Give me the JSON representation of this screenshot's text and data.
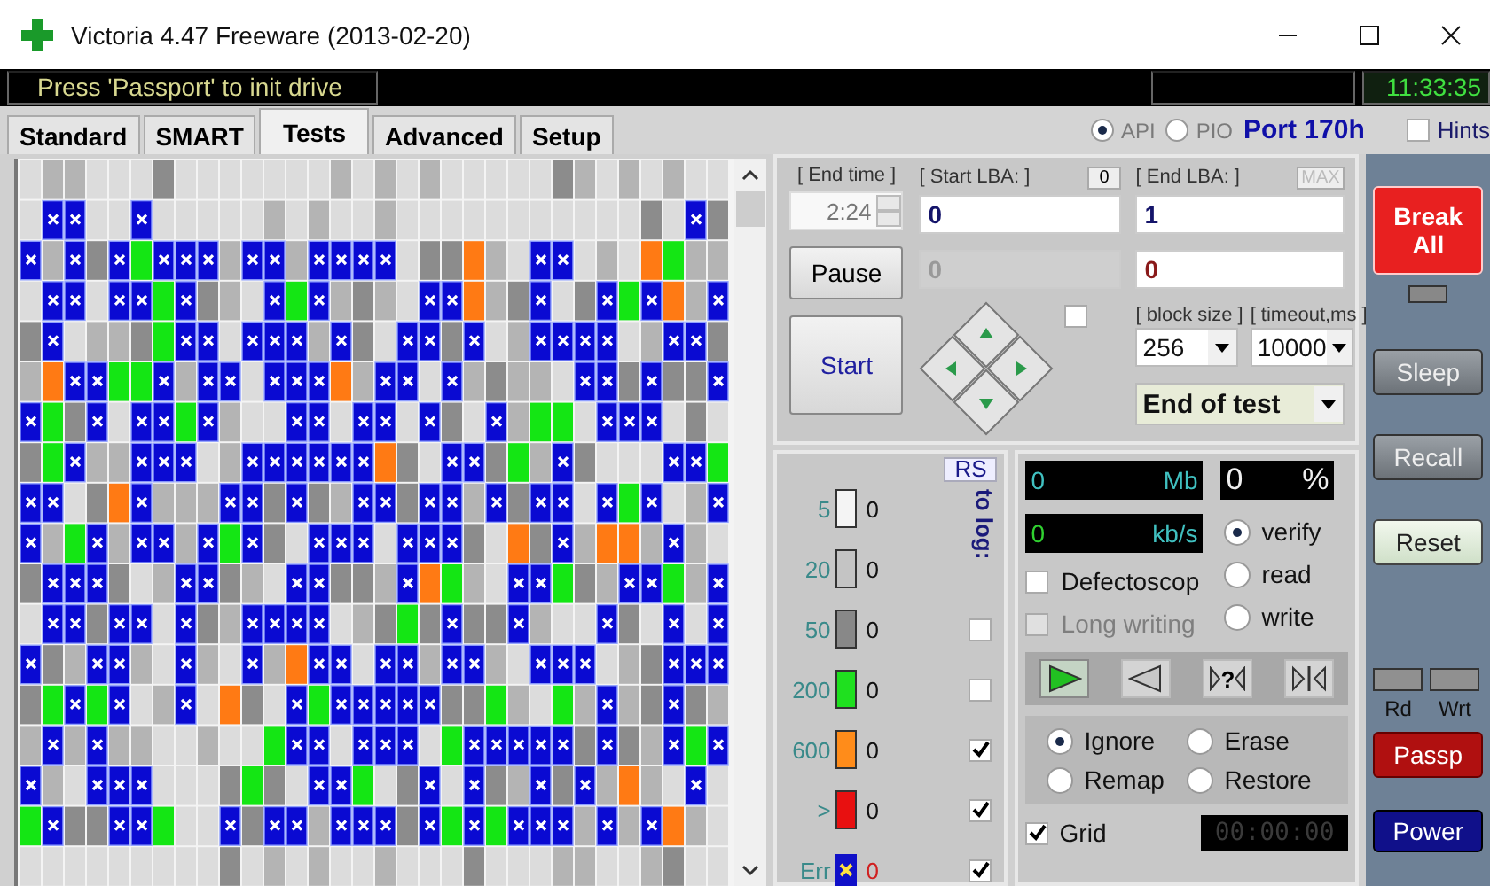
{
  "window": {
    "title": "Victoria 4.47  Freeware (2013-02-20)"
  },
  "status_bar": {
    "message": "Press 'Passport' to init drive",
    "clock": "11:33:35"
  },
  "tabs": [
    {
      "label": "Standard",
      "selected": false
    },
    {
      "label": "SMART",
      "selected": false
    },
    {
      "label": "Tests",
      "selected": true
    },
    {
      "label": "Advanced",
      "selected": false
    },
    {
      "label": "Setup",
      "selected": false
    }
  ],
  "interface": {
    "options": [
      {
        "label": "API",
        "selected": true,
        "disabled": true
      },
      {
        "label": "PIO",
        "selected": false,
        "disabled": true
      }
    ],
    "port": "Port 170h"
  },
  "hints": {
    "label": "Hints",
    "checked": false
  },
  "range": {
    "end_time_label": "[ End time ]",
    "end_time": "2:24",
    "start_lba_label": "[ Start LBA: ]",
    "start_lba_reset": "0",
    "end_lba_label": "[ End LBA: ]",
    "end_lba_max": "MAX",
    "start_lba": "0",
    "end_lba": "1",
    "current_lba": "0",
    "error_lba": "0"
  },
  "buttons": {
    "pause": "Pause",
    "start": "Start"
  },
  "navigator": {
    "checked": false
  },
  "block_size": {
    "label": "[ block size ]",
    "value": "256"
  },
  "timeout": {
    "label": "[ timeout,ms ]",
    "value": "10000"
  },
  "end_action": {
    "value": "End of test"
  },
  "legend": {
    "reset": "RS",
    "to_log": "to log:",
    "items": [
      {
        "kind": "bar",
        "label": "5",
        "count": "0",
        "color": "#f4f4f4"
      },
      {
        "kind": "bar",
        "label": "20",
        "count": "0",
        "color": "#c4c4c4"
      },
      {
        "kind": "bar",
        "label": "50",
        "count": "0",
        "color": "#888888"
      },
      {
        "kind": "bar",
        "label": "200",
        "count": "0",
        "color": "#1fe01f"
      },
      {
        "kind": "bar",
        "label": "600",
        "count": "0",
        "color": "#ff8c1a"
      },
      {
        "kind": "bar",
        "label": ">",
        "count": "0",
        "color": "#e81010"
      },
      {
        "kind": "error",
        "label": "Err",
        "count": "0",
        "color": "#1010c8"
      }
    ]
  },
  "log": [
    {
      "checked": false
    },
    {
      "checked": false
    },
    {
      "checked": true
    },
    {
      "checked": true
    },
    {
      "checked": true
    }
  ],
  "readouts": {
    "mb": "0",
    "mb_unit": "Mb",
    "percent": "0",
    "percent_unit": "%",
    "speed": "0",
    "speed_unit": "kb/s"
  },
  "modes": [
    {
      "label": "verify",
      "selected": true
    },
    {
      "label": "read",
      "selected": false
    },
    {
      "label": "write",
      "selected": false
    }
  ],
  "options": [
    {
      "label": "Defectoscop",
      "checked": false,
      "disabled": false
    },
    {
      "label": "Long writing",
      "checked": false,
      "disabled": true
    }
  ],
  "transport": [
    {
      "kind": "forward",
      "selected": true
    },
    {
      "kind": "backward",
      "selected": false
    },
    {
      "kind": "repair",
      "label": "?",
      "selected": false
    },
    {
      "kind": "end",
      "selected": false
    }
  ],
  "actions": [
    {
      "label": "Ignore",
      "selected": true
    },
    {
      "label": "Erase",
      "selected": false
    },
    {
      "label": "Remap",
      "selected": false
    },
    {
      "label": "Restore",
      "selected": false
    }
  ],
  "grid": {
    "label": "Grid",
    "checked": true
  },
  "timer": "00:00:00",
  "side": {
    "break": "Break All",
    "sleep": "Sleep",
    "recall": "Recall",
    "reset": "Reset",
    "read_label": "Rd",
    "write_label": "Wrt",
    "passport": "Passp",
    "power": "Power"
  }
}
